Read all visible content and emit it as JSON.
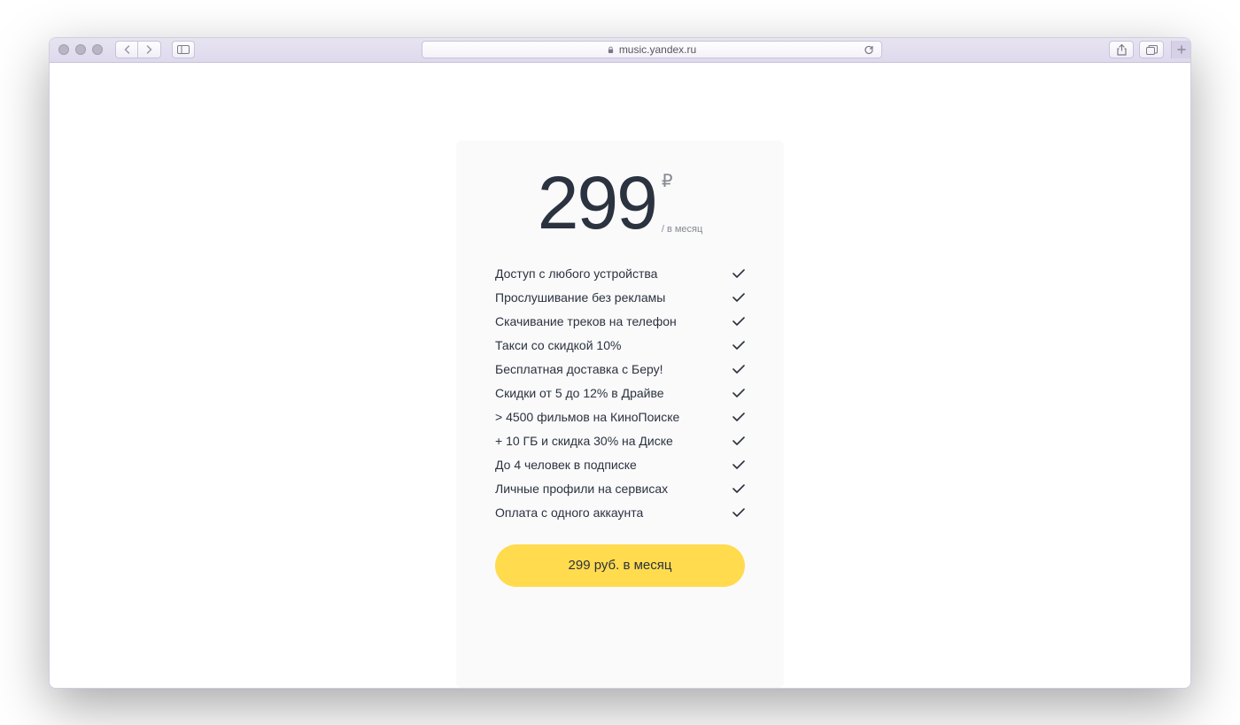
{
  "browser": {
    "url": "music.yandex.ru"
  },
  "pricing": {
    "amount": "299",
    "currency": "₽",
    "period": "/ в месяц",
    "features": [
      "Доступ с любого устройства",
      "Прослушивание без рекламы",
      "Скачивание треков на телефон",
      "Такси со скидкой 10%",
      "Бесплатная доставка с Беру!",
      "Скидки от 5 до 12% в Драйве",
      "> 4500 фильмов на КиноПоиске",
      "+ 10 ГБ и скидка 30% на Диске",
      "До 4 человек в подписке",
      "Личные профили на сервисах",
      "Оплата с одного аккаунта"
    ],
    "cta": "299 руб. в месяц"
  }
}
